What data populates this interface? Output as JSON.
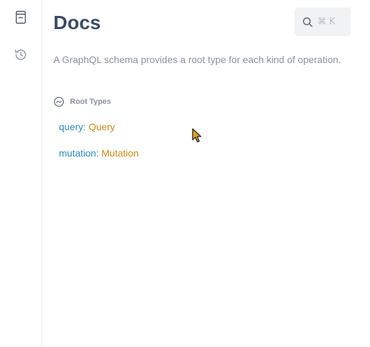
{
  "sidebar": {
    "items": [
      {
        "icon": "docs-book-icon"
      },
      {
        "icon": "history-icon"
      }
    ]
  },
  "docs": {
    "title": "Docs",
    "search": {
      "shortcut": "⌘ K",
      "icon": "search-icon"
    },
    "description": "A GraphQL schema provides a root type for each kind of operation.",
    "section": {
      "title": "Root Types",
      "icon": "root-types-icon"
    },
    "root_types": [
      {
        "field": "query",
        "colon": ":",
        "type": "Query"
      },
      {
        "field": "mutation",
        "colon": ":",
        "type": "Mutation"
      }
    ]
  },
  "colors": {
    "title": "#3b4b68",
    "muted_text": "#8a91a0",
    "field": "#2b8bc0",
    "type": "#c98a10",
    "search_bg": "#f1f2f4"
  }
}
